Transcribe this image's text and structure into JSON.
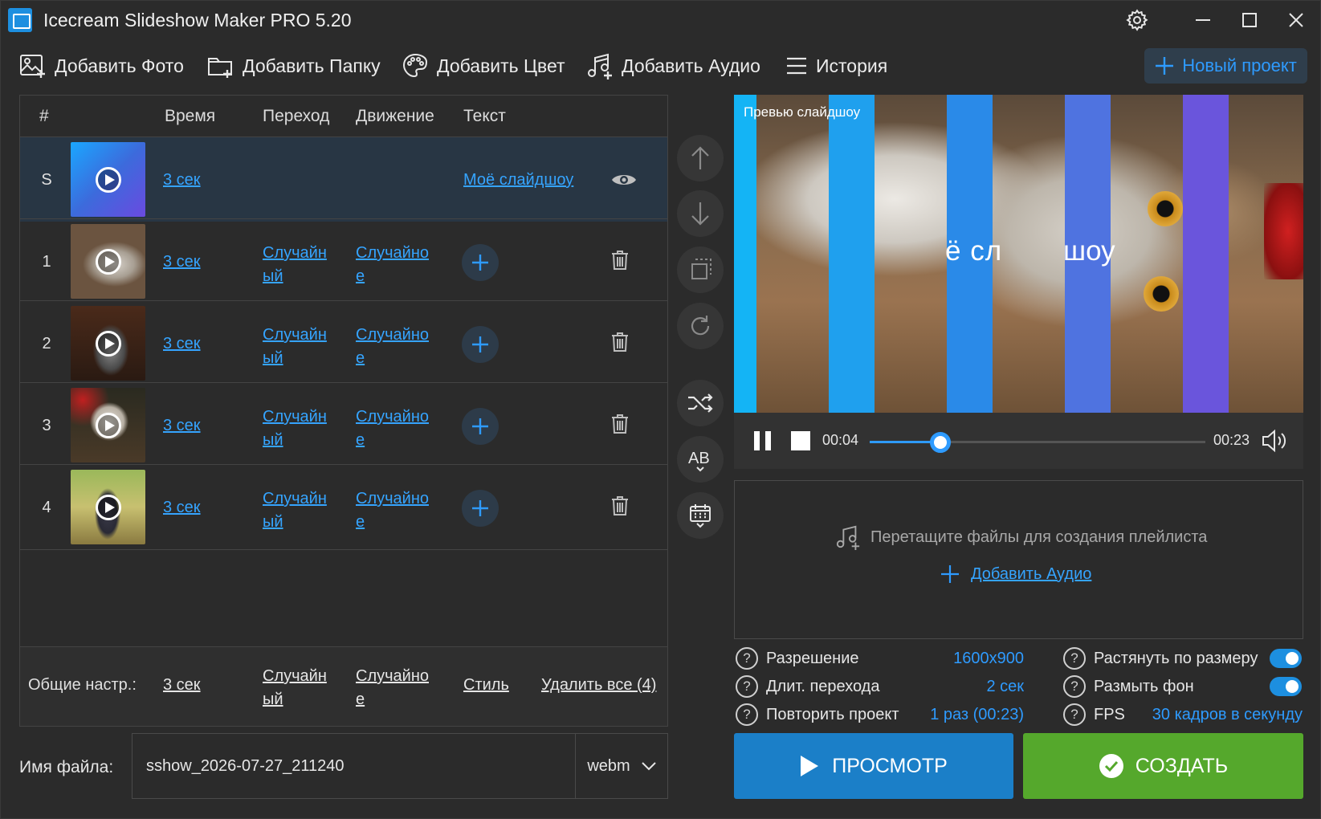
{
  "window": {
    "title": "Icecream Slideshow Maker PRO 5.20"
  },
  "toolbar": {
    "add_photo": "Добавить Фото",
    "add_folder": "Добавить Папку",
    "add_color": "Добавить Цвет",
    "add_audio": "Добавить Аудио",
    "history": "История",
    "new_project": "Новый проект"
  },
  "table": {
    "headers": {
      "num": "#",
      "time": "Время",
      "transition": "Переход",
      "motion": "Движение",
      "text": "Текст"
    },
    "title_row": {
      "num": "S",
      "time": "3 сек",
      "text": "Моё слайдшоу"
    },
    "rows": [
      {
        "num": "1",
        "time": "3 сек",
        "transition_a": "Случайн",
        "transition_b": "ый",
        "motion_a": "Случайно",
        "motion_b": "е"
      },
      {
        "num": "2",
        "time": "3 сек",
        "transition_a": "Случайн",
        "transition_b": "ый",
        "motion_a": "Случайно",
        "motion_b": "е"
      },
      {
        "num": "3",
        "time": "3 сек",
        "transition_a": "Случайн",
        "transition_b": "ый",
        "motion_a": "Случайно",
        "motion_b": "е"
      },
      {
        "num": "4",
        "time": "3 сек",
        "transition_a": "Случайн",
        "transition_b": "ый",
        "motion_a": "Случайно",
        "motion_b": "е"
      }
    ],
    "footer": {
      "label": "Общие настр.:",
      "time": "3 сек",
      "transition_a": "Случайн",
      "transition_b": "ый",
      "motion_a": "Случайно",
      "motion_b": "е",
      "style": "Стиль",
      "delete_all": "Удалить все (4)"
    }
  },
  "preview": {
    "label": "Превью слайдшоу",
    "overlay_text_a": "ё сл",
    "overlay_text_b": "шоу",
    "current_time": "00:04",
    "total_time": "00:23",
    "progress": 0.21
  },
  "audio": {
    "drop_hint": "Перетащите файлы для создания плейлиста",
    "add_audio": "Добавить Аудио"
  },
  "settings": {
    "resolution_label": "Разрешение",
    "resolution_value": "1600x900",
    "transition_label": "Длит. перехода",
    "transition_value": "2 сек",
    "repeat_label": "Повторить проект",
    "repeat_value": "1 раз (00:23)",
    "stretch_label": "Растянуть по размеру",
    "stretch_on": true,
    "blur_label": "Размыть фон",
    "blur_on": true,
    "fps_label": "FPS",
    "fps_value": "30 кадров в секунду"
  },
  "bottom": {
    "filename_label": "Имя файла:",
    "filename_value": "sshow_2026-07-27_211240",
    "format": "webm",
    "preview_button": "ПРОСМОТР",
    "create_button": "СОЗДАТЬ"
  },
  "colors": {
    "accent": "#2e9bff",
    "preview_button": "#1b7fc8",
    "create_button": "#55a82c",
    "background": "#2b2b2b"
  }
}
